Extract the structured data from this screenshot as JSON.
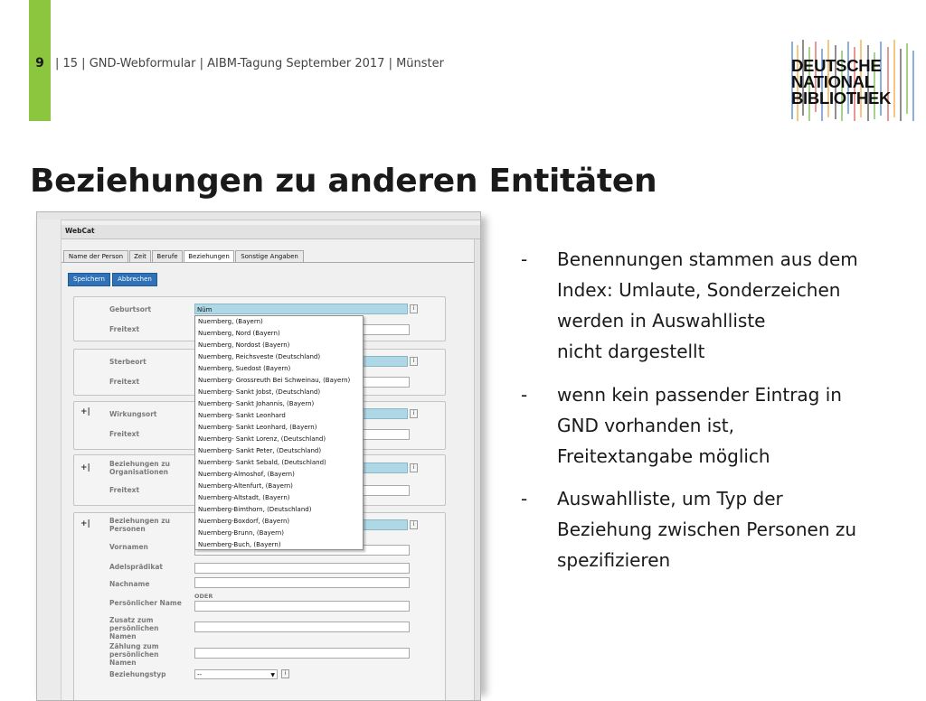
{
  "header": {
    "page_number": "9",
    "meta": "| 15 | GND-Webformular | AIBM-Tagung September 2017 | Münster"
  },
  "logo": {
    "line1": "DEUTSCHE",
    "line2": "NATIONAL",
    "line3": "BIBLIOTHEK"
  },
  "title": "Beziehungen zu anderen Entitäten",
  "webcat": {
    "app_name": "WebCat",
    "tabs": [
      "Name der Person",
      "Zeit",
      "Berufe",
      "Beziehungen",
      "Sonstige Angaben"
    ],
    "buttons": {
      "save": "Speichern",
      "cancel": "Abbrechen"
    },
    "fields": {
      "geburtsort": "Geburtsort",
      "geburtsort_value": "Nüm",
      "freitext": "Freitext",
      "sterbeort": "Sterbeort",
      "wirkungsort": "Wirkungsort",
      "beziehungen_org_1": "Beziehungen zu",
      "beziehungen_org_2": "Organisationen",
      "beziehungen_pers_1": "Beziehungen zu",
      "beziehungen_pers_2": "Personen",
      "vornamen": "Vornamen",
      "adelspraedikat": "Adelsprädikat",
      "nachname": "Nachname",
      "persoenlicher_name": "Persönlicher Name",
      "oder": "ODER",
      "zusatz_1": "Zusatz zum",
      "zusatz_2": "persönlichen",
      "zusatz_3": "Namen",
      "zaehlung_1": "Zählung zum",
      "zaehlung_2": "persönlichen",
      "zaehlung_3": "Namen",
      "beziehungstyp": "Beziehungstyp",
      "beziehungstyp_value": "--",
      "plus": "+|",
      "info": "i"
    },
    "dropdown_items": [
      "Nuernberg, (Bayern)",
      "Nuernberg, Nord (Bayern)",
      "Nuernberg, Nordost (Bayern)",
      "Nuernberg, Reichsveste (Deutschland)",
      "Nuernberg, Suedost (Bayern)",
      "Nuernberg- Grossreuth Bei Schweinau, (Bayern)",
      "Nuernberg- Sankt Jobst, (Deutschland)",
      "Nuernberg- Sankt Johannis, (Bayern)",
      "Nuernberg- Sankt Leonhard",
      "Nuernberg- Sankt Leonhard, (Bayern)",
      "Nuernberg- Sankt Lorenz, (Deutschland)",
      "Nuernberg- Sankt Peter, (Deutschland)",
      "Nuernberg- Sankt Sebald, (Deutschland)",
      "Nuernberg-Almoshof, (Bayern)",
      "Nuernberg-Altenfurt, (Bayern)",
      "Nuernberg-Altstadt, (Bayern)",
      "Nuernberg-Bimthorn, (Deutschland)",
      "Nuernberg-Boxdorf, (Bayern)",
      "Nuernberg-Brunn, (Bayern)",
      "Nuernberg-Buch, (Bayern)"
    ]
  },
  "bullets": [
    {
      "dash": "-",
      "lines": [
        "Benennungen stammen aus dem",
        "Index: Umlaute, Sonderzeichen",
        "werden in Auswahlliste",
        "nicht dargestellt"
      ]
    },
    {
      "dash": "-",
      "lines": [
        "wenn kein passender Eintrag in",
        "GND vorhanden ist,",
        "Freitextangabe möglich"
      ]
    },
    {
      "dash": "-",
      "lines": [
        "Auswahlliste, um Typ der",
        "Beziehung zwischen Personen zu",
        "spezifizieren"
      ]
    }
  ],
  "colors": {
    "accent_green": "#8cc63f",
    "button_blue": "#2f72b8",
    "highlight_field": "#aed8e6"
  }
}
